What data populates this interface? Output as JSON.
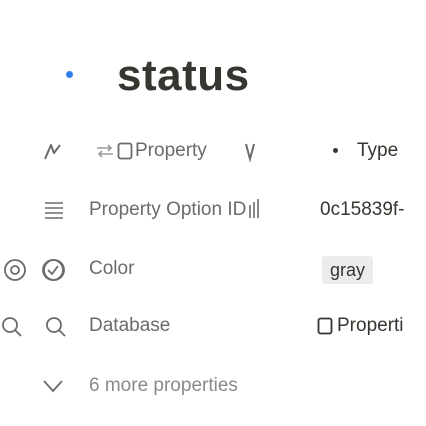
{
  "page": {
    "title": "status"
  },
  "header_row": {
    "property_label": "Property",
    "type_label": "Type"
  },
  "rows": [
    {
      "icon": "list-icon",
      "label": "Property Option ID",
      "value": "0c15839f-"
    },
    {
      "icon": "circle-check-icon",
      "label": "Color",
      "value": "gray"
    },
    {
      "icon": "search-icon",
      "label": "Database",
      "value": "Properti"
    }
  ],
  "more": {
    "label": "6 more properties"
  },
  "colors": {
    "text": "#37352f",
    "muted": "#6b6b6b",
    "tag_bg": "#ebeced",
    "accent_dot": "#2f80ed"
  }
}
